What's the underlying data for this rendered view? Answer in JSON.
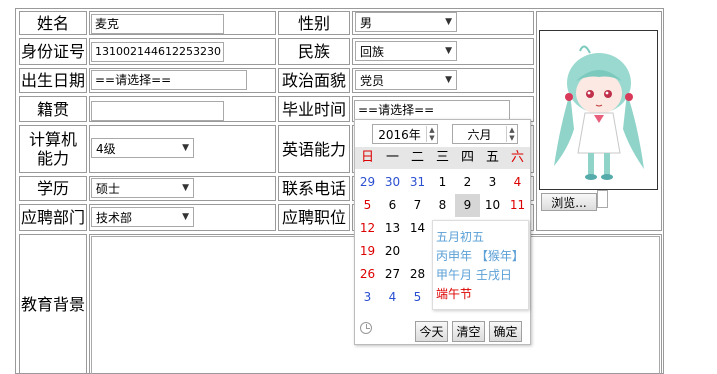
{
  "form": {
    "name_label": "姓名",
    "name_value": "麦克",
    "gender_label": "性别",
    "gender_value": "男",
    "id_label": "身份证号",
    "id_value": "131002144612253230",
    "ethnic_label": "民族",
    "ethnic_value": "回族",
    "birth_label": "出生日期",
    "birth_value": "==请选择==",
    "political_label": "政治面貌",
    "political_value": "党员",
    "native_label": "籍贯",
    "native_value": "",
    "grad_label": "毕业时间",
    "grad_value": "==请选择==",
    "computer_label": "计算机能力",
    "computer_value": "4级",
    "english_label": "英语能力",
    "education_label": "学历",
    "education_value": "硕士",
    "phone_label": "联系电话",
    "dept_label": "应聘部门",
    "dept_value": "技术部",
    "position_label": "应聘职位",
    "edu_bg_label": "教育背景",
    "browse_label": "浏览..."
  },
  "calendar": {
    "year": "2016年",
    "month": "六月",
    "weekdays": [
      "日",
      "一",
      "二",
      "三",
      "四",
      "五",
      "六"
    ],
    "days": [
      [
        "29",
        "30",
        "31",
        "1",
        "2",
        "3",
        "4"
      ],
      [
        "5",
        "6",
        "7",
        "8",
        "9",
        "10",
        "11"
      ],
      [
        "12",
        "13",
        "14",
        "",
        "",
        "",
        ""
      ],
      [
        "19",
        "20",
        "",
        "",
        "",
        "",
        ""
      ],
      [
        "26",
        "27",
        "28",
        "",
        "",
        "",
        ""
      ],
      [
        "3",
        "4",
        "5",
        "",
        "",
        "",
        ""
      ]
    ],
    "selected_day": "9",
    "tooltip": {
      "line1": "五月初五",
      "line2": "丙申年 【猴年】",
      "line3": "甲午月  壬戌日",
      "festival": "端午节"
    },
    "today_label": "今天",
    "clear_label": "清空",
    "ok_label": "确定"
  }
}
